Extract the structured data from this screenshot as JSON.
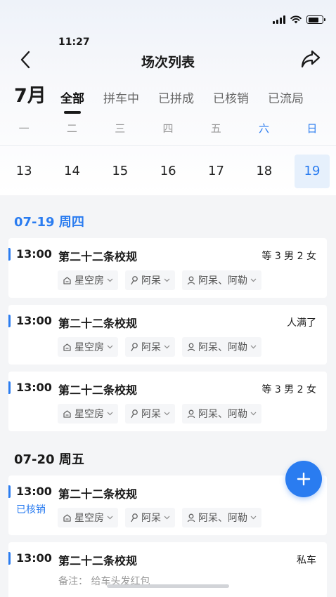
{
  "status_bar": {
    "time": "11:27"
  },
  "nav": {
    "title": "场次列表",
    "back_icon": "chevron-left-icon",
    "share_icon": "share-icon"
  },
  "filter": {
    "month": "7月",
    "tabs": [
      {
        "label": "全部",
        "active": true
      },
      {
        "label": "拼车中",
        "active": false
      },
      {
        "label": "已拼成",
        "active": false
      },
      {
        "label": "已核销",
        "active": false
      },
      {
        "label": "已流局",
        "active": false
      }
    ]
  },
  "calendar": {
    "weekdays": [
      "一",
      "二",
      "三",
      "四",
      "五",
      "六",
      "日"
    ],
    "dates": [
      "13",
      "14",
      "15",
      "16",
      "17",
      "18",
      "19"
    ],
    "selected": "19"
  },
  "groups": [
    {
      "title": "07-19 周四"
    },
    {
      "title": "07-20 周五"
    }
  ],
  "sessions": [
    {
      "time": "13:00",
      "name": "第二十二条校规",
      "right": "等 3 男 2 女",
      "room": "星空房",
      "host": "阿呆",
      "players": "阿呆、阿勒"
    },
    {
      "time": "13:00",
      "name": "第二十二条校规",
      "right": "人满了",
      "room": "星空房",
      "host": "阿呆",
      "players": "阿呆、阿勒"
    },
    {
      "time": "13:00",
      "name": "第二十二条校规",
      "right": "等 3 男 2 女",
      "room": "星空房",
      "host": "阿呆",
      "players": "阿呆、阿勒"
    },
    {
      "time": "13:00",
      "status": "已核销",
      "name": "第二十二条校规",
      "room": "星空房",
      "host": "阿呆",
      "players": "阿呆、阿勒"
    },
    {
      "time": "13:00",
      "name": "第二十二条校规",
      "right": "私车",
      "note": "备注： 给车头发红包"
    }
  ],
  "fab": {
    "icon": "plus-icon"
  },
  "colors": {
    "accent": "#2a7cf0",
    "background": "#f4f5f7"
  }
}
